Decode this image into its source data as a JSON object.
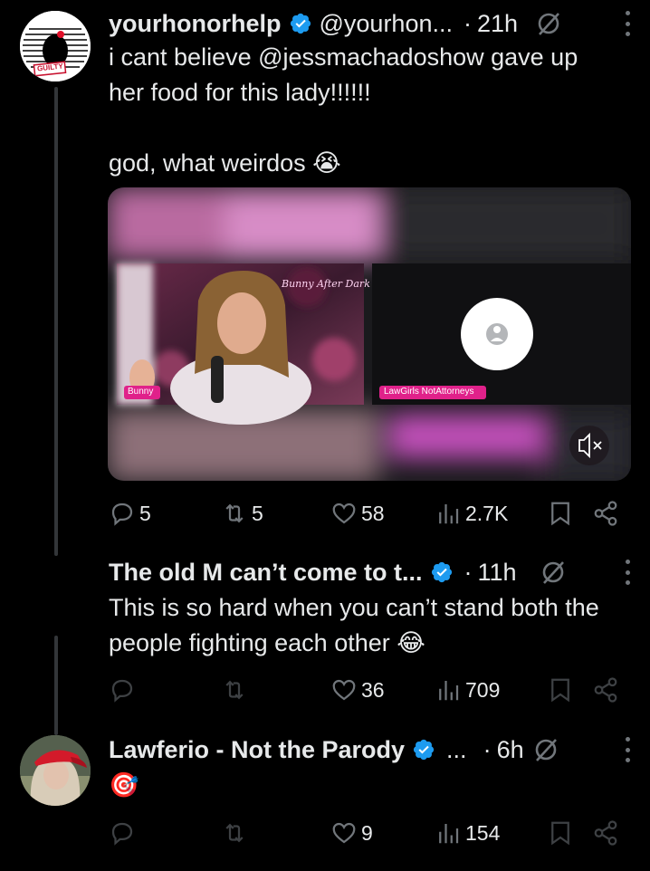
{
  "tweets": [
    {
      "name": "yourhonorhelp",
      "handle": "@yourhon...",
      "dot": "·",
      "time": "21h",
      "avatar_badge": "GUILTY",
      "text": "i cant believe @jessmachadoshow gave up\nher food for this lady!!!!!!\n\ngod, what weirdos 😭",
      "media": {
        "neon_sign": "Bunny After Dark",
        "left_tag": "Bunny",
        "right_tag": "LawGirls NotAttorneys",
        "mute_icon": "speaker-muted-icon"
      },
      "stats": {
        "replies": "5",
        "reposts": "5",
        "likes": "58",
        "views": "2.7K"
      }
    },
    {
      "name": "The old M can’t come to t...",
      "dot": "·",
      "time": "11h",
      "text": "This is so hard when you can’t stand both the\npeople fighting each other 😂",
      "stats": {
        "replies": "",
        "reposts": "",
        "likes": "36",
        "views": "709"
      }
    },
    {
      "name": "Lawferio - Not the Parody",
      "handle": "...",
      "dot": "·",
      "time": "6h",
      "text": "🎯",
      "stats": {
        "replies": "",
        "reposts": "",
        "likes": "9",
        "views": "154"
      }
    }
  ],
  "colors": {
    "verified": "#1d9bf0",
    "text": "#e7e9ea",
    "muted": "#71767b",
    "tag": "#e0218a"
  }
}
